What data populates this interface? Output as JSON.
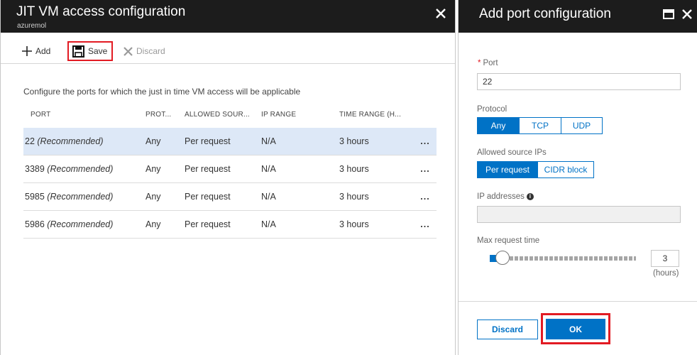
{
  "left_blade": {
    "title": "JIT VM access configuration",
    "subtitle": "azuremol",
    "toolbar": {
      "add_label": "Add",
      "save_label": "Save",
      "discard_label": "Discard"
    },
    "description": "Configure the ports for which the just in time VM access will be applicable",
    "columns": [
      "PORT",
      "PROT...",
      "ALLOWED SOUR...",
      "IP RANGE",
      "TIME RANGE (H..."
    ],
    "rows": [
      {
        "port": "22",
        "note": "(Recommended)",
        "protocol": "Any",
        "allowed_source": "Per request",
        "ip_range": "N/A",
        "time_range": "3 hours",
        "more": "..."
      },
      {
        "port": "3389",
        "note": "(Recommended)",
        "protocol": "Any",
        "allowed_source": "Per request",
        "ip_range": "N/A",
        "time_range": "3 hours",
        "more": "..."
      },
      {
        "port": "5985",
        "note": "(Recommended)",
        "protocol": "Any",
        "allowed_source": "Per request",
        "ip_range": "N/A",
        "time_range": "3 hours",
        "more": "..."
      },
      {
        "port": "5986",
        "note": "(Recommended)",
        "protocol": "Any",
        "allowed_source": "Per request",
        "ip_range": "N/A",
        "time_range": "3 hours",
        "more": "..."
      }
    ]
  },
  "right_blade": {
    "title": "Add port configuration",
    "port": {
      "required_mark": "*",
      "label": "Port",
      "value": "22"
    },
    "protocol": {
      "label": "Protocol",
      "options": [
        "Any",
        "TCP",
        "UDP"
      ],
      "selected": "Any"
    },
    "allowed_source": {
      "label": "Allowed source IPs",
      "options": [
        "Per request",
        "CIDR block"
      ],
      "selected": "Per request"
    },
    "ip_addresses": {
      "label": "IP addresses",
      "info_glyph": "i",
      "value": ""
    },
    "max_request_time": {
      "label": "Max request time",
      "value": "3",
      "unit": "(hours)"
    },
    "buttons": {
      "discard": "Discard",
      "ok": "OK"
    }
  },
  "colors": {
    "accent": "#0072c6",
    "header_bg": "#1c1c1c",
    "highlight_red": "#e21b23",
    "selected_row": "#dde8f7"
  }
}
